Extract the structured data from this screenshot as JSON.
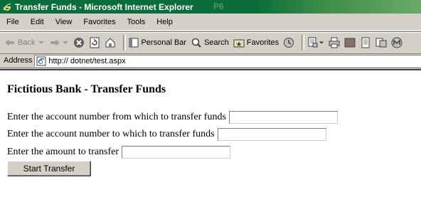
{
  "window": {
    "title": "Transfer Funds - Microsoft Internet Explorer",
    "watermark": "P6"
  },
  "menu": [
    "File",
    "Edit",
    "View",
    "Favorites",
    "Tools",
    "Help"
  ],
  "toolbar": {
    "back": "Back",
    "personal_bar": "Personal Bar",
    "search": "Search",
    "favorites": "Favorites"
  },
  "address": {
    "label": "Address",
    "url": "http:// dotnet/test.aspx"
  },
  "page": {
    "heading": "Fictitious Bank - Transfer Funds",
    "from_label": "Enter the account number from which to transfer funds",
    "to_label": "Enter the account number to which to transfer funds",
    "amount_label": "Enter the amount to transfer",
    "from_value": "",
    "to_value": "",
    "amount_value": "",
    "submit_label": "Start Transfer"
  }
}
